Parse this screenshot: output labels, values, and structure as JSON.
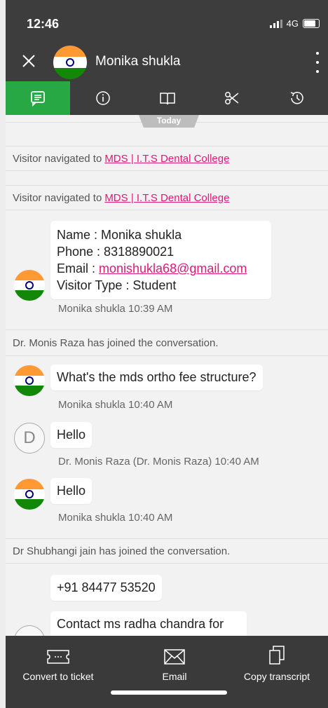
{
  "status_bar": {
    "time": "12:46",
    "network": "4G"
  },
  "header": {
    "title": "Monika shukla",
    "close_icon": "close-icon",
    "menu_icon": "kebab-menu-icon"
  },
  "tabs": [
    {
      "icon": "chat-icon",
      "active": true
    },
    {
      "icon": "info-icon",
      "active": false
    },
    {
      "icon": "book-icon",
      "active": false
    },
    {
      "icon": "scissors-icon",
      "active": false
    },
    {
      "icon": "history-icon",
      "active": false
    }
  ],
  "chat": {
    "date_divider": "Today",
    "events": [
      {
        "prefix": "Visitor navigated to",
        "link": "MDS | I.T.S Dental College"
      },
      {
        "prefix": "Visitor navigated to",
        "link": "MDS | I.T.S Dental College"
      }
    ],
    "visitor_card": {
      "name": "Name : Monika shukla",
      "phone": "Phone : 8318890021",
      "email_label": "Email : ",
      "email": "monishukla68@gmail.com",
      "visitor_type": "Visitor Type : Student",
      "meta": "Monika shukla 10:39 AM"
    },
    "join_1": "Dr. Monis Raza has joined the conversation.",
    "messages": [
      {
        "text": "What's the mds ortho fee structure?",
        "meta": "Monika shukla 10:40 AM"
      },
      {
        "text": "Hello",
        "meta": "Dr. Monis Raza (Dr. Monis Raza) 10:40 AM",
        "avatar_letter": "D"
      },
      {
        "text": "Hello",
        "meta": "Monika shukla 10:40 AM"
      }
    ],
    "join_2": "Dr Shubhangi jain has joined the conversation.",
    "agent_messages": [
      {
        "text": "+91 84477 53520"
      },
      {
        "text": "Contact ms radha chandra for"
      }
    ]
  },
  "bottom_bar": {
    "convert": "Convert to ticket",
    "email": "Email",
    "copy": "Copy transcript"
  },
  "colors": {
    "accent_green": "#27a844",
    "link_pink": "#e0187a",
    "header_bg": "#3d3d3d"
  }
}
